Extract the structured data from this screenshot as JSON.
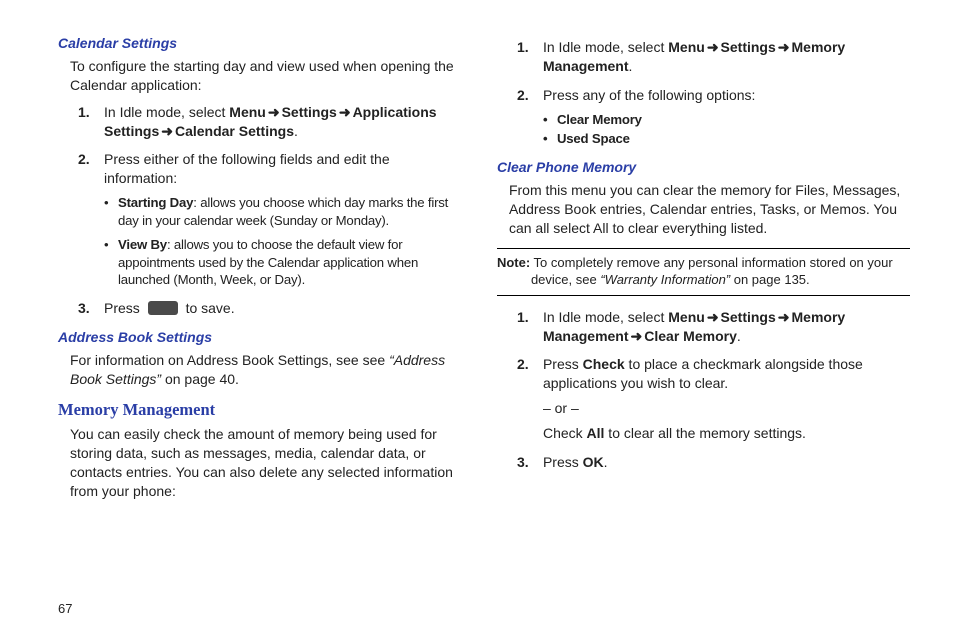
{
  "left": {
    "calendar": {
      "heading": "Calendar Settings",
      "intro": "To configure the starting day and view used when opening the Calendar application:",
      "step1_a": "In Idle mode, select ",
      "step1_menu": "Menu",
      "step1_settings": "Settings",
      "step1_apps": "Applications Settings",
      "step1_cal": "Calendar Settings",
      "step2": "Press either of the following fields and edit the information:",
      "bullet1_b": "Starting Day",
      "bullet1_r": ": allows you choose which day marks the first day in your calendar week (Sunday or Monday).",
      "bullet2_b": "View By",
      "bullet2_r": ": allows you to choose the default view for appointments used by the Calendar application when launched (Month, Week, or Day).",
      "step3_a": "Press",
      "step3_b": "to save."
    },
    "address": {
      "heading": "Address Book Settings",
      "text_a": "For information on Address Book Settings, see see ",
      "text_q": "“Address Book Settings”",
      "text_b": " on page 40."
    },
    "memory": {
      "heading": "Memory Management",
      "text": "You can easily check the amount of memory being used for storing data, such as messages, media, calendar data, or contacts entries. You can also delete any selected information from your phone:"
    }
  },
  "right": {
    "top": {
      "step1_a": "In Idle mode, select ",
      "step1_menu": "Menu",
      "step1_settings": "Settings",
      "step1_mem": "Memory Management",
      "step2": "Press any of the following options:",
      "bullet1": "Clear Memory",
      "bullet2": "Used Space"
    },
    "clear": {
      "heading": "Clear Phone Memory",
      "intro": "From this menu you can clear the memory for Files, Messages, Address Book entries, Calendar entries, Tasks, or Memos. You can all select All to clear everything listed."
    },
    "note": {
      "label": "Note:",
      "text": " To completely remove any personal information stored on your device, see ",
      "ref": "“Warranty Information”",
      "after": " on page 135."
    },
    "steps": {
      "step1_a": "In Idle mode, select ",
      "step1_menu": "Menu",
      "step1_settings": "Settings",
      "step1_mem": "Memory Management",
      "step1_clr": "Clear Memory",
      "step2_a": "Press ",
      "step2_check": "Check",
      "step2_b": " to place a checkmark alongside those applications you wish to clear.",
      "step2_or": "– or –",
      "step2_c1": "Check ",
      "step2_all": "All",
      "step2_c2": " to clear all the memory settings.",
      "step3_a": "Press ",
      "step3_ok": "OK",
      "step3_dot": "."
    }
  },
  "arrow": "➜",
  "dot": ".",
  "pageNum": "67"
}
